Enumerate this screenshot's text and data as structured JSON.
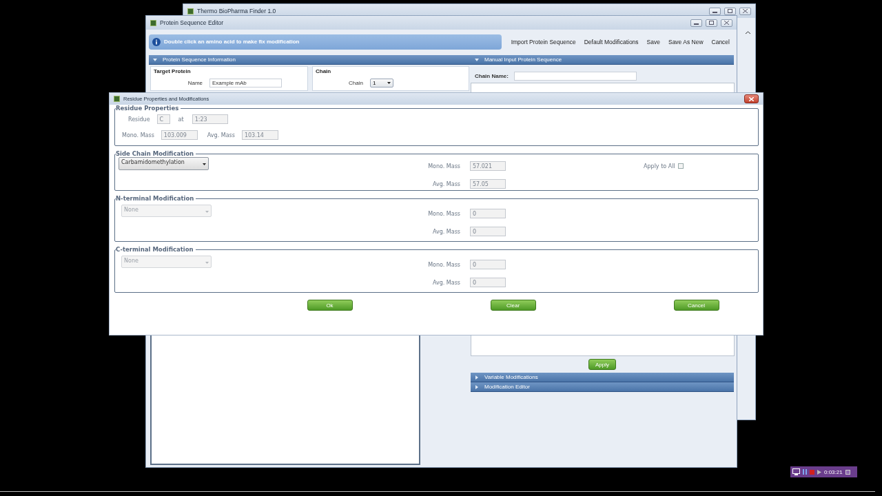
{
  "main_window": {
    "title": "Thermo BioPharma Finder 1.0"
  },
  "editor": {
    "title": "Protein Sequence Editor",
    "info": "Double click an amino acid to make fix modification",
    "toolbar": [
      "Import Protein Sequence",
      "Default Modifications",
      "Save",
      "Save As New",
      "Cancel"
    ],
    "sections": [
      {
        "title": "Protein Sequence Information",
        "expanded": true
      },
      {
        "title": "Manual Input Protein Sequence",
        "expanded": true
      }
    ],
    "target_protein": {
      "heading": "Target Protein",
      "name_label": "Name",
      "name_value": "Example mAb"
    },
    "chain": {
      "heading": "Chain",
      "label": "Chain",
      "value": "1"
    },
    "chain_name": {
      "label": "Chain Name:"
    },
    "apply_button": "Apply",
    "collapsed_sections": [
      {
        "title": "Variable Modifications",
        "expanded": false
      },
      {
        "title": "Modification Editor",
        "expanded": false
      }
    ]
  },
  "dialog": {
    "title": "Residue Properties and Modifications",
    "residue_properties": {
      "legend": "Residue Properties",
      "residue_label": "Residue",
      "residue": "C",
      "at_label": "at",
      "position": "1:23",
      "mono_label": "Mono. Mass",
      "mono": "103.009",
      "avg_label": "Avg. Mass",
      "avg": "103.14"
    },
    "modifications": [
      {
        "legend": "Side Chain Modification",
        "value": "Carbamidomethylation",
        "disabled": false,
        "mono_label": "Mono. Mass",
        "mono": "57.021",
        "avg_label": "Avg. Mass",
        "avg": "57.05",
        "apply_to_all": {
          "label": "Apply to All",
          "checked": false
        }
      },
      {
        "legend": "N-terminal Modification",
        "value": "None",
        "disabled": true,
        "mono_label": "Mono. Mass",
        "mono": "0",
        "avg_label": "Avg. Mass",
        "avg": "0"
      },
      {
        "legend": "C-terminal Modification",
        "value": "None",
        "disabled": true,
        "mono_label": "Mono. Mass",
        "mono": "0",
        "avg_label": "Avg. Mass",
        "avg": "0"
      }
    ],
    "buttons": [
      "Ok",
      "Clear",
      "Cancel"
    ]
  },
  "recorder": {
    "time": "0:03:21"
  }
}
